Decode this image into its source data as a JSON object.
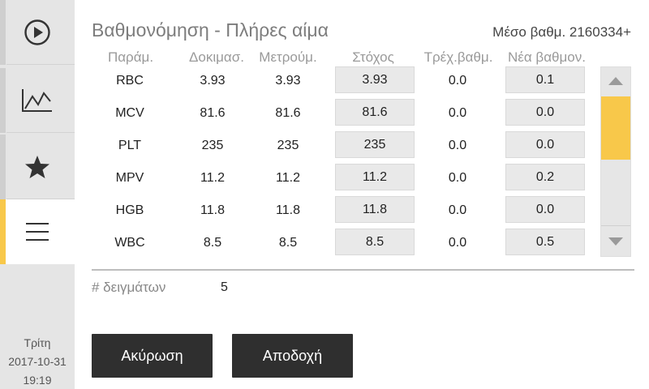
{
  "title": "Βαθμονόμηση - Πλήρες αίμα",
  "average_label": "Μέσο βαθμ. 2160334+",
  "columns": [
    "Παράμ.",
    "Δοκιμασ.",
    "Μετρούμ.",
    "Στόχος",
    "Τρέχ.βαθμ.",
    "Νέα βαθμον."
  ],
  "rows": [
    {
      "param": "RBC",
      "test": "3.93",
      "measured": "3.93",
      "target": "3.93",
      "current": "0.0",
      "new": "0.1"
    },
    {
      "param": "MCV",
      "test": "81.6",
      "measured": "81.6",
      "target": "81.6",
      "current": "0.0",
      "new": "0.0"
    },
    {
      "param": "PLT",
      "test": "235",
      "measured": "235",
      "target": "235",
      "current": "0.0",
      "new": "0.0"
    },
    {
      "param": "MPV",
      "test": "11.2",
      "measured": "11.2",
      "target": "11.2",
      "current": "0.0",
      "new": "0.2"
    },
    {
      "param": "HGB",
      "test": "11.8",
      "measured": "11.8",
      "target": "11.8",
      "current": "0.0",
      "new": "0.0"
    },
    {
      "param": "WBC",
      "test": "8.5",
      "measured": "8.5",
      "target": "8.5",
      "current": "0.0",
      "new": "0.5"
    }
  ],
  "samples": {
    "label": "# δειγμάτων",
    "value": "5"
  },
  "buttons": {
    "cancel": "Ακύρωση",
    "accept": "Αποδοχή"
  },
  "sidebar": {
    "items": [
      {
        "name": "play-icon"
      },
      {
        "name": "chart-icon"
      },
      {
        "name": "star-icon"
      },
      {
        "name": "menu-icon",
        "active": true
      }
    ],
    "day": "Τρίτη",
    "date": "2017-10-31",
    "time": "19:19"
  },
  "colors": {
    "accent": "#f8c84a",
    "button": "#2f2f2f",
    "sidebar": "#e5e5e5"
  }
}
